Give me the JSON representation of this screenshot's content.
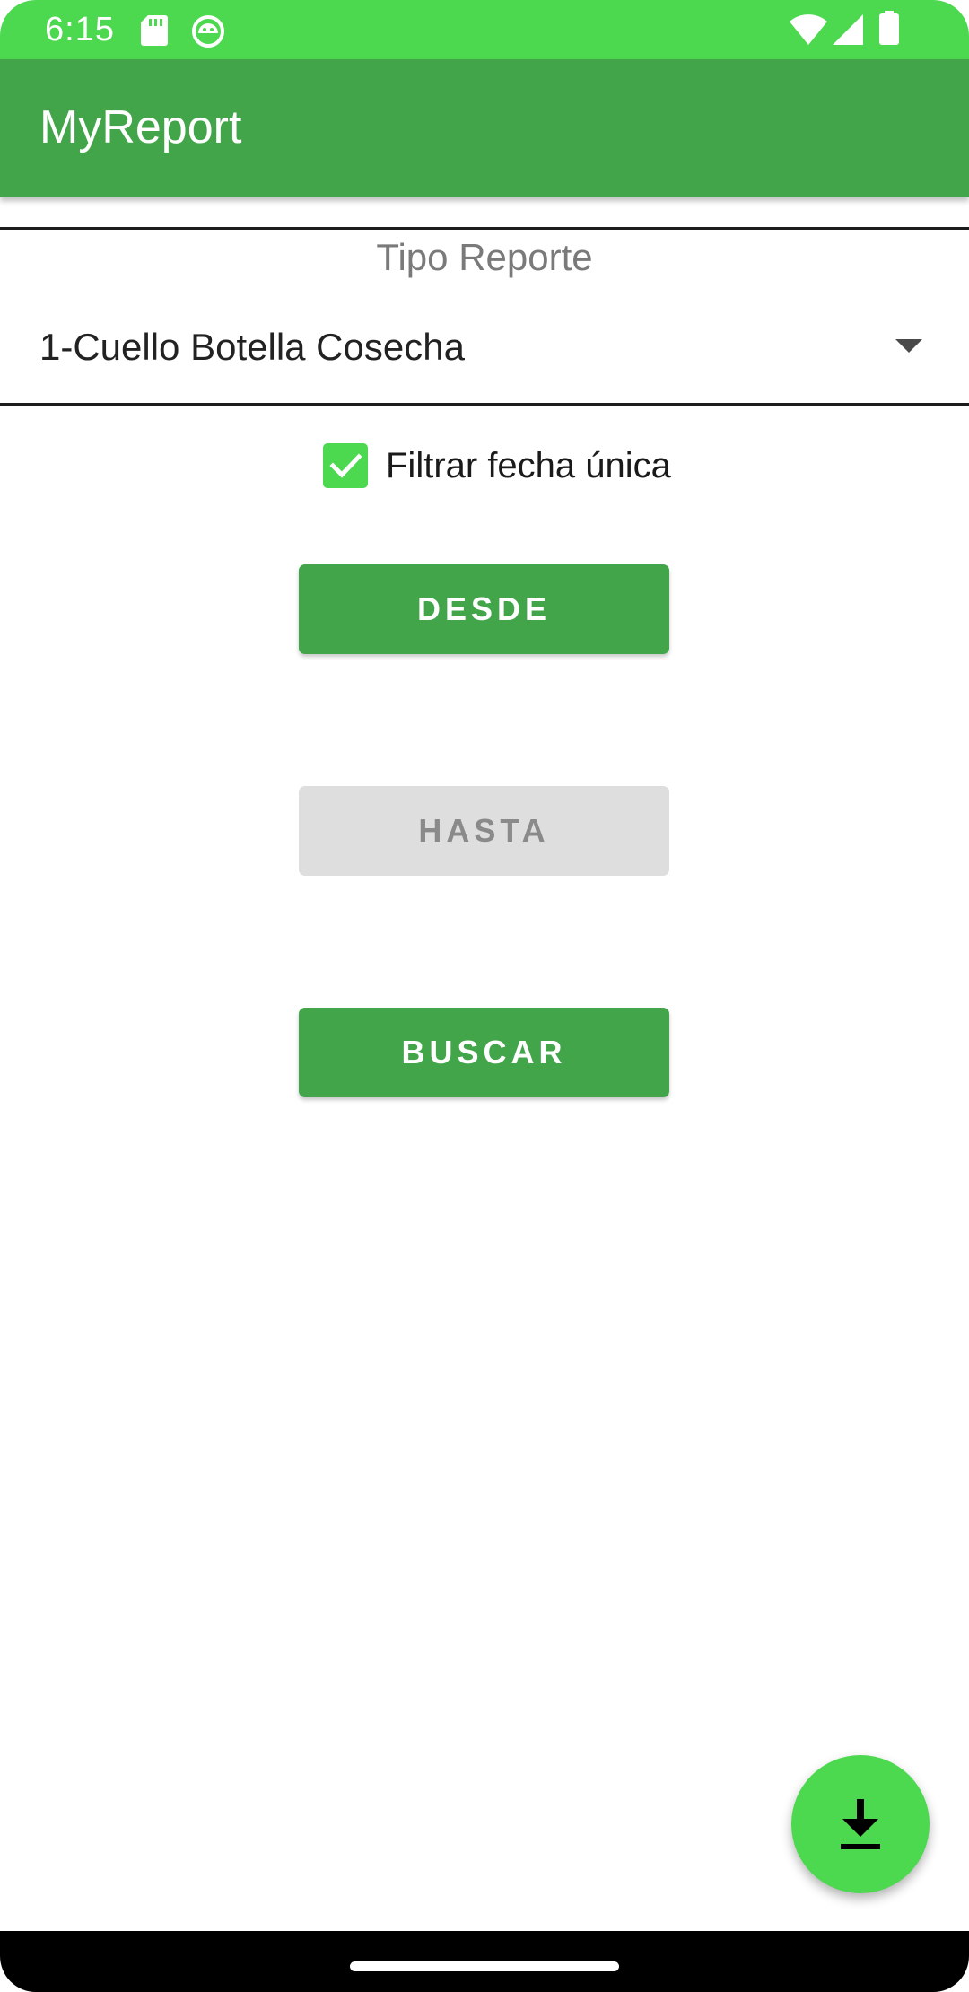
{
  "status_bar": {
    "time": "6:15",
    "icons_left": [
      "sd-card-icon",
      "android-debug-icon"
    ],
    "icons_right": [
      "wifi-icon",
      "cell-signal-icon",
      "battery-icon"
    ]
  },
  "app_bar": {
    "title": "MyReport"
  },
  "report_type": {
    "label": "Tipo Reporte",
    "selected": "1-Cuello Botella Cosecha"
  },
  "filter": {
    "label": "Filtrar fecha única",
    "checked": true
  },
  "buttons": {
    "desde": "DESDE",
    "hasta": "HASTA",
    "buscar": "BUSCAR"
  },
  "fab": {
    "icon": "download-icon"
  },
  "colors": {
    "status_bar": "#4cd84f",
    "app_bar": "#43a54a",
    "button_primary": "#43a54a",
    "button_disabled": "#dedede",
    "fab": "#4cd84f"
  }
}
